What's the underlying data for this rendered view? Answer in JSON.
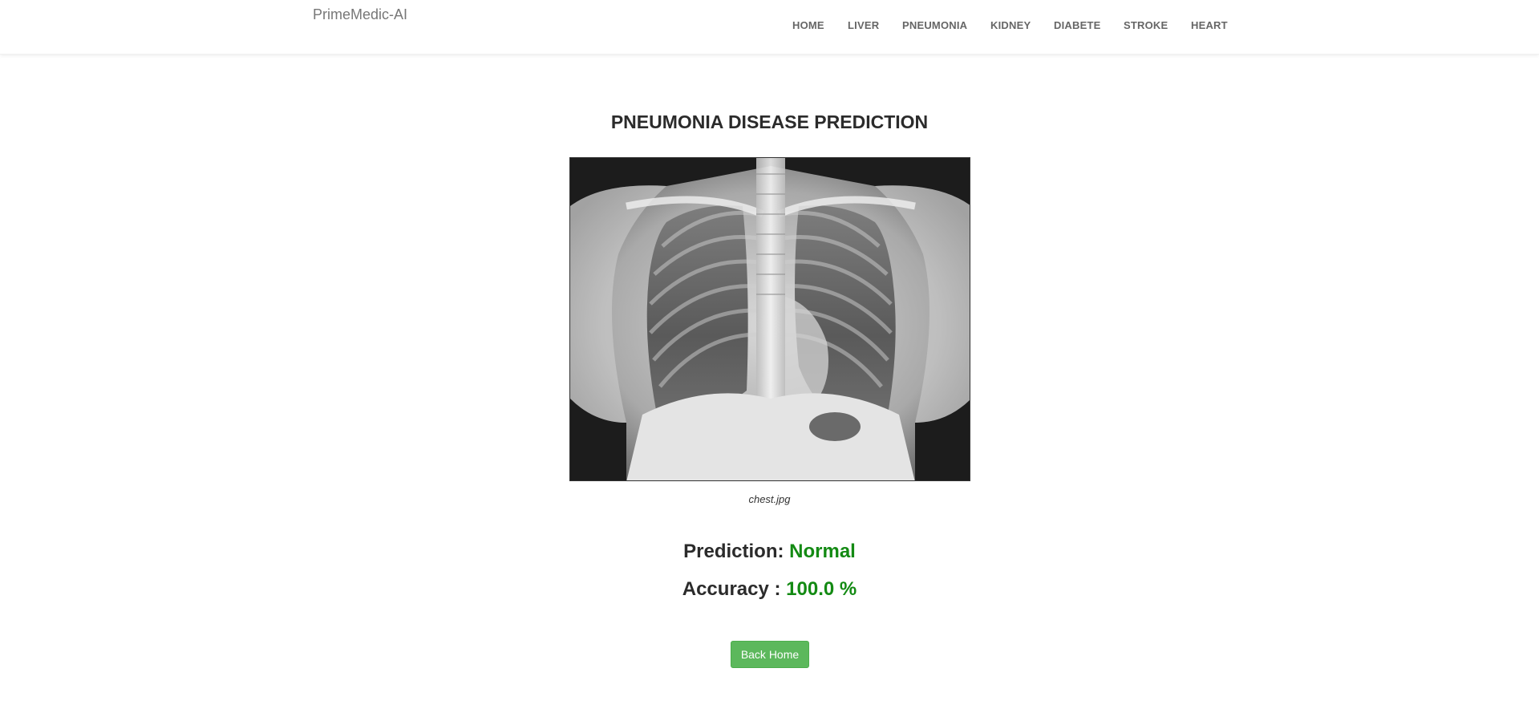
{
  "app": {
    "brand": "PrimeMedic-AI"
  },
  "nav": {
    "items": [
      {
        "label": "HOME"
      },
      {
        "label": "LIVER"
      },
      {
        "label": "PNEUMONIA"
      },
      {
        "label": "KIDNEY"
      },
      {
        "label": "DIABETE"
      },
      {
        "label": "STROKE"
      },
      {
        "label": "HEART"
      }
    ]
  },
  "main": {
    "title": "PNEUMONIA DISEASE PREDICTION",
    "image_caption": "chest.jpg",
    "image_icon": "chest-xray-image",
    "prediction_label": "Prediction:",
    "prediction_value": "Normal",
    "accuracy_label": "Accuracy :",
    "accuracy_value": "100.0 %",
    "back_button_label": "Back Home"
  },
  "colors": {
    "accent_green": "#138a13",
    "button_green": "#5cb85c",
    "nav_text": "#666666",
    "brand_text": "#777777"
  }
}
